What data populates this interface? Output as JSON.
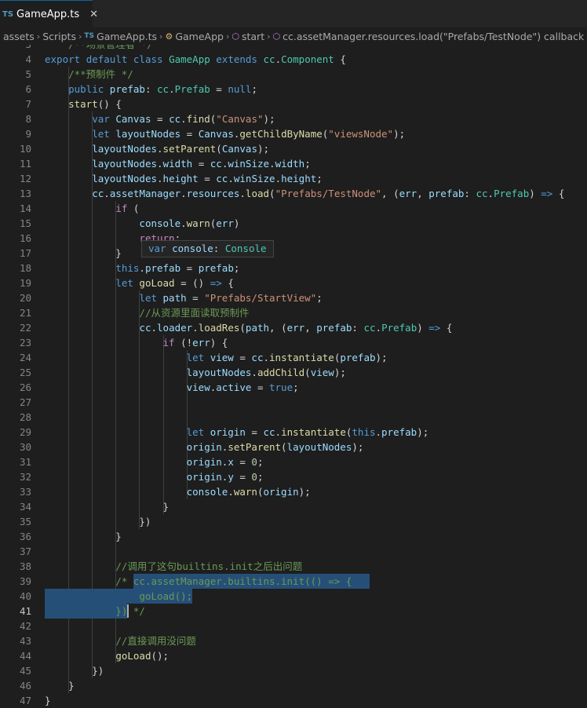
{
  "tab": {
    "badge": "TS",
    "title": "GameApp.ts",
    "close": "✕"
  },
  "breadcrumb": {
    "items": [
      "assets",
      "Scripts",
      "GameApp.ts",
      "GameApp",
      "start",
      "cc.assetManager.resources.load(\"Prefabs/TestNode\") callback"
    ],
    "ts_badge": "TS"
  },
  "hover": {
    "text": "var console: Console"
  },
  "colors": {
    "keyword": "#569cd6",
    "control": "#c586c0",
    "string": "#ce9178",
    "number": "#b5cea8",
    "comment": "#6a9955",
    "function": "#dcdcaa",
    "type": "#4ec9b0",
    "variable": "#9cdcfe",
    "selection": "#264f78"
  },
  "editor": {
    "active_line": 41,
    "lines": [
      {
        "n": 3,
        "code": [
          [
            "cmt",
            "    /**场景管理者 */"
          ]
        ]
      },
      {
        "n": 4,
        "code": [
          [
            "kw",
            "export "
          ],
          [
            "kw",
            "default "
          ],
          [
            "kw",
            "class "
          ],
          [
            "ty",
            "GameApp "
          ],
          [
            "kw",
            "extends "
          ],
          [
            "ty",
            "cc"
          ],
          [
            "",
            "."
          ],
          [
            "ty",
            "Component"
          ],
          [
            "",
            " {"
          ]
        ]
      },
      {
        "n": 5,
        "code": [
          [
            "",
            "    "
          ],
          [
            "cmt",
            "/**预制件 */"
          ]
        ]
      },
      {
        "n": 6,
        "code": [
          [
            "",
            "    "
          ],
          [
            "kw",
            "public "
          ],
          [
            "var",
            "prefab"
          ],
          [
            "",
            ": "
          ],
          [
            "ty",
            "cc"
          ],
          [
            "",
            "."
          ],
          [
            "ty",
            "Prefab"
          ],
          [
            "",
            " = "
          ],
          [
            "kw",
            "null"
          ],
          [
            "",
            ";"
          ]
        ]
      },
      {
        "n": 7,
        "code": [
          [
            "",
            "    "
          ],
          [
            "fn",
            "start"
          ],
          [
            "",
            "() {"
          ]
        ]
      },
      {
        "n": 8,
        "code": [
          [
            "",
            "        "
          ],
          [
            "kw",
            "var "
          ],
          [
            "var",
            "Canvas"
          ],
          [
            "",
            " = "
          ],
          [
            "var",
            "cc"
          ],
          [
            "",
            "."
          ],
          [
            "fn",
            "find"
          ],
          [
            "",
            "("
          ],
          [
            "str",
            "\"Canvas\""
          ],
          [
            "",
            ");"
          ]
        ]
      },
      {
        "n": 9,
        "code": [
          [
            "",
            "        "
          ],
          [
            "kw",
            "let "
          ],
          [
            "var",
            "layoutNodes"
          ],
          [
            "",
            " = "
          ],
          [
            "var",
            "Canvas"
          ],
          [
            "",
            "."
          ],
          [
            "fn",
            "getChildByName"
          ],
          [
            "",
            "("
          ],
          [
            "str",
            "\"viewsNode\""
          ],
          [
            "",
            ");"
          ]
        ]
      },
      {
        "n": 10,
        "code": [
          [
            "",
            "        "
          ],
          [
            "var",
            "layoutNodes"
          ],
          [
            "",
            "."
          ],
          [
            "fn",
            "setParent"
          ],
          [
            "",
            "("
          ],
          [
            "var",
            "Canvas"
          ],
          [
            "",
            ");"
          ]
        ]
      },
      {
        "n": 11,
        "code": [
          [
            "",
            "        "
          ],
          [
            "var",
            "layoutNodes"
          ],
          [
            "",
            "."
          ],
          [
            "var",
            "width"
          ],
          [
            "",
            " = "
          ],
          [
            "var",
            "cc"
          ],
          [
            "",
            "."
          ],
          [
            "var",
            "winSize"
          ],
          [
            "",
            "."
          ],
          [
            "var",
            "width"
          ],
          [
            "",
            ";"
          ]
        ]
      },
      {
        "n": 12,
        "code": [
          [
            "",
            "        "
          ],
          [
            "var",
            "layoutNodes"
          ],
          [
            "",
            "."
          ],
          [
            "var",
            "height"
          ],
          [
            "",
            " = "
          ],
          [
            "var",
            "cc"
          ],
          [
            "",
            "."
          ],
          [
            "var",
            "winSize"
          ],
          [
            "",
            "."
          ],
          [
            "var",
            "height"
          ],
          [
            "",
            ";"
          ]
        ]
      },
      {
        "n": 13,
        "code": [
          [
            "",
            "        "
          ],
          [
            "var",
            "cc"
          ],
          [
            "",
            "."
          ],
          [
            "var",
            "assetManager"
          ],
          [
            "",
            "."
          ],
          [
            "var",
            "resources"
          ],
          [
            "",
            "."
          ],
          [
            "fn",
            "load"
          ],
          [
            "",
            "("
          ],
          [
            "str",
            "\"Prefabs/TestNode\""
          ],
          [
            "",
            ", ("
          ],
          [
            "var",
            "err"
          ],
          [
            "",
            ", "
          ],
          [
            "var",
            "prefab"
          ],
          [
            "",
            ": "
          ],
          [
            "ty",
            "cc"
          ],
          [
            "",
            "."
          ],
          [
            "ty",
            "Prefab"
          ],
          [
            "",
            ") "
          ],
          [
            "kw",
            "=>"
          ],
          [
            "",
            " {"
          ]
        ]
      },
      {
        "n": 14,
        "code": [
          [
            "",
            "            "
          ],
          [
            "ctl",
            "if"
          ],
          [
            "",
            " ("
          ]
        ]
      },
      {
        "n": 15,
        "code": [
          [
            "",
            "                "
          ],
          [
            "var",
            "console"
          ],
          [
            "",
            "."
          ],
          [
            "fn",
            "warn"
          ],
          [
            "",
            "("
          ],
          [
            "var",
            "err"
          ],
          [
            "",
            ")"
          ]
        ]
      },
      {
        "n": 16,
        "code": [
          [
            "",
            "                "
          ],
          [
            "ctl",
            "return"
          ],
          [
            "",
            ";"
          ]
        ]
      },
      {
        "n": 17,
        "code": [
          [
            "",
            "            }"
          ]
        ]
      },
      {
        "n": 18,
        "code": [
          [
            "",
            "            "
          ],
          [
            "kw",
            "this"
          ],
          [
            "",
            "."
          ],
          [
            "var",
            "prefab"
          ],
          [
            "",
            " = "
          ],
          [
            "var",
            "prefab"
          ],
          [
            "",
            ";"
          ]
        ]
      },
      {
        "n": 19,
        "code": [
          [
            "",
            "            "
          ],
          [
            "kw",
            "let "
          ],
          [
            "fn",
            "goLoad"
          ],
          [
            "",
            " = () "
          ],
          [
            "kw",
            "=>"
          ],
          [
            "",
            " {"
          ]
        ]
      },
      {
        "n": 20,
        "code": [
          [
            "",
            "                "
          ],
          [
            "kw",
            "let "
          ],
          [
            "var",
            "path"
          ],
          [
            "",
            " = "
          ],
          [
            "str",
            "\"Prefabs/StartView\""
          ],
          [
            "",
            ";"
          ]
        ]
      },
      {
        "n": 21,
        "code": [
          [
            "",
            "                "
          ],
          [
            "cmt",
            "//从资源里面读取预制件"
          ]
        ]
      },
      {
        "n": 22,
        "code": [
          [
            "",
            "                "
          ],
          [
            "var",
            "cc"
          ],
          [
            "",
            "."
          ],
          [
            "var",
            "loader"
          ],
          [
            "",
            "."
          ],
          [
            "fn",
            "loadRes"
          ],
          [
            "",
            "("
          ],
          [
            "var",
            "path"
          ],
          [
            "",
            ", ("
          ],
          [
            "var",
            "err"
          ],
          [
            "",
            ", "
          ],
          [
            "var",
            "prefab"
          ],
          [
            "",
            ": "
          ],
          [
            "ty",
            "cc"
          ],
          [
            "",
            "."
          ],
          [
            "ty",
            "Prefab"
          ],
          [
            "",
            ") "
          ],
          [
            "kw",
            "=>"
          ],
          [
            "",
            " {"
          ]
        ]
      },
      {
        "n": 23,
        "code": [
          [
            "",
            "                    "
          ],
          [
            "ctl",
            "if"
          ],
          [
            "",
            " (!"
          ],
          [
            "var",
            "err"
          ],
          [
            "",
            ") {"
          ]
        ]
      },
      {
        "n": 24,
        "code": [
          [
            "",
            "                        "
          ],
          [
            "kw",
            "let "
          ],
          [
            "var",
            "view"
          ],
          [
            "",
            " = "
          ],
          [
            "var",
            "cc"
          ],
          [
            "",
            "."
          ],
          [
            "fn",
            "instantiate"
          ],
          [
            "",
            "("
          ],
          [
            "var",
            "prefab"
          ],
          [
            "",
            ");"
          ]
        ]
      },
      {
        "n": 25,
        "code": [
          [
            "",
            "                        "
          ],
          [
            "var",
            "layoutNodes"
          ],
          [
            "",
            "."
          ],
          [
            "fn",
            "addChild"
          ],
          [
            "",
            "("
          ],
          [
            "var",
            "view"
          ],
          [
            "",
            ");"
          ]
        ]
      },
      {
        "n": 26,
        "code": [
          [
            "",
            "                        "
          ],
          [
            "var",
            "view"
          ],
          [
            "",
            "."
          ],
          [
            "var",
            "active"
          ],
          [
            "",
            " = "
          ],
          [
            "kw",
            "true"
          ],
          [
            "",
            ";"
          ]
        ]
      },
      {
        "n": 27,
        "code": [
          [
            "",
            ""
          ]
        ]
      },
      {
        "n": 28,
        "code": [
          [
            "",
            ""
          ]
        ]
      },
      {
        "n": 29,
        "code": [
          [
            "",
            "                        "
          ],
          [
            "kw",
            "let "
          ],
          [
            "var",
            "origin"
          ],
          [
            "",
            " = "
          ],
          [
            "var",
            "cc"
          ],
          [
            "",
            "."
          ],
          [
            "fn",
            "instantiate"
          ],
          [
            "",
            "("
          ],
          [
            "kw",
            "this"
          ],
          [
            "",
            "."
          ],
          [
            "var",
            "prefab"
          ],
          [
            "",
            ");"
          ]
        ]
      },
      {
        "n": 30,
        "code": [
          [
            "",
            "                        "
          ],
          [
            "var",
            "origin"
          ],
          [
            "",
            "."
          ],
          [
            "fn",
            "setParent"
          ],
          [
            "",
            "("
          ],
          [
            "var",
            "layoutNodes"
          ],
          [
            "",
            ");"
          ]
        ]
      },
      {
        "n": 31,
        "code": [
          [
            "",
            "                        "
          ],
          [
            "var",
            "origin"
          ],
          [
            "",
            "."
          ],
          [
            "var",
            "x"
          ],
          [
            "",
            " = "
          ],
          [
            "num",
            "0"
          ],
          [
            "",
            ";"
          ]
        ]
      },
      {
        "n": 32,
        "code": [
          [
            "",
            "                        "
          ],
          [
            "var",
            "origin"
          ],
          [
            "",
            "."
          ],
          [
            "var",
            "y"
          ],
          [
            "",
            " = "
          ],
          [
            "num",
            "0"
          ],
          [
            "",
            ";"
          ]
        ]
      },
      {
        "n": 33,
        "code": [
          [
            "",
            "                        "
          ],
          [
            "var",
            "console"
          ],
          [
            "",
            "."
          ],
          [
            "fn",
            "warn"
          ],
          [
            "",
            "("
          ],
          [
            "var",
            "origin"
          ],
          [
            "",
            ");"
          ]
        ]
      },
      {
        "n": 34,
        "code": [
          [
            "",
            "                    }"
          ]
        ]
      },
      {
        "n": 35,
        "code": [
          [
            "",
            "                })"
          ]
        ]
      },
      {
        "n": 36,
        "code": [
          [
            "",
            "            }"
          ]
        ]
      },
      {
        "n": 37,
        "code": [
          [
            "",
            ""
          ]
        ]
      },
      {
        "n": 38,
        "code": [
          [
            "",
            "            "
          ],
          [
            "cmt",
            "//调用了这句builtins.init之后出问题"
          ]
        ]
      },
      {
        "n": 39,
        "code": [
          [
            "",
            "            "
          ],
          [
            "cmt",
            "/* cc.assetManager.builtins.init(() => {"
          ]
        ]
      },
      {
        "n": 40,
        "code": [
          [
            "cmt",
            "                goLoad();"
          ]
        ]
      },
      {
        "n": 41,
        "code": [
          [
            "cmt",
            "            }) */"
          ]
        ]
      },
      {
        "n": 42,
        "code": [
          [
            "",
            ""
          ]
        ]
      },
      {
        "n": 43,
        "code": [
          [
            "",
            "            "
          ],
          [
            "cmt",
            "//直接调用没问题"
          ]
        ]
      },
      {
        "n": 44,
        "code": [
          [
            "",
            "            "
          ],
          [
            "fn",
            "goLoad"
          ],
          [
            "",
            "();"
          ]
        ]
      },
      {
        "n": 45,
        "code": [
          [
            "",
            "        })"
          ]
        ]
      },
      {
        "n": 46,
        "code": [
          [
            "",
            "    }"
          ]
        ]
      },
      {
        "n": 47,
        "code": [
          [
            "",
            "}"
          ]
        ]
      }
    ]
  }
}
